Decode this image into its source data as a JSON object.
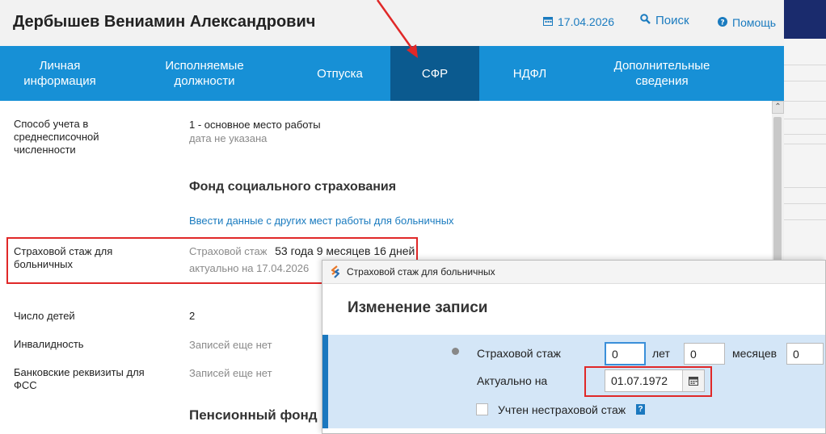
{
  "header": {
    "employee_name": "Дербышев Вениамин Александрович",
    "date": "17.04.2026",
    "search_label": "Поиск",
    "help_label": "Помощь"
  },
  "tabs": [
    {
      "label": "Личная информация",
      "active": false
    },
    {
      "label": "Исполняемые должности",
      "active": false
    },
    {
      "label": "Отпуска",
      "active": false
    },
    {
      "label": "СФР",
      "active": true
    },
    {
      "label": "НДФЛ",
      "active": false
    },
    {
      "label": "Дополнительные сведения",
      "active": false
    }
  ],
  "content": {
    "accounting_method": {
      "label": "Способ учета в среднесписочной численности",
      "value": "1 - основное место работы",
      "note": "дата не указана"
    },
    "fss_title": "Фонд социального страхования",
    "other_jobs_link": "Ввести данные с других мест работы для больничных",
    "insurance_experience": {
      "label": "Страховой стаж для больничных",
      "caption": "Страховой стаж",
      "value": "53 года 9 месяцев 16 дней",
      "actual_on": "актуально на 17.04.2026"
    },
    "children": {
      "label": "Число детей",
      "value": "2"
    },
    "disability": {
      "label": "Инвалидность",
      "value": "Записей еще нет"
    },
    "bank_details": {
      "label": "Банковские реквизиты для ФСС",
      "value": "Записей еще нет"
    },
    "pension_title": "Пенсионный фонд"
  },
  "dialog": {
    "window_title": "Страховой стаж для больничных",
    "heading": "Изменение записи",
    "experience_label": "Страховой стаж",
    "years_value": "0",
    "years_unit": "лет",
    "months_value": "0",
    "months_unit": "месяцев",
    "days_value": "0",
    "actual_label": "Актуально на",
    "actual_date": "01.07.1972",
    "non_insurance_label": "Учтен нестраховой стаж",
    "help_glyph": "?"
  },
  "colors": {
    "tab_bar": "#1790d6",
    "tab_active": "#0b5a8f",
    "link": "#1a7bbf",
    "highlight_red": "#e02828",
    "row_bg": "#d4e6f7"
  }
}
